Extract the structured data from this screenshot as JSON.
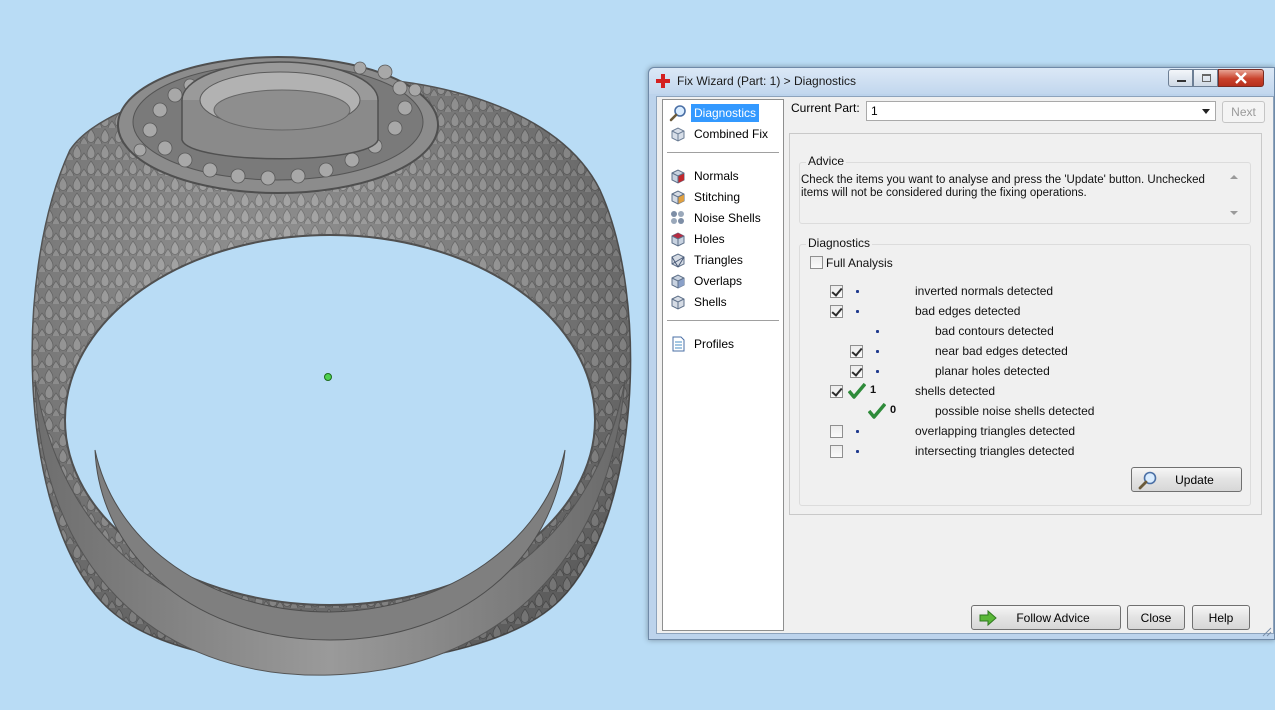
{
  "window": {
    "title": "Fix Wizard (Part: 1) > Diagnostics"
  },
  "nav": {
    "items": [
      {
        "label": "Diagnostics",
        "icon": "magnifier-icon",
        "selected": true
      },
      {
        "label": "Combined Fix",
        "icon": "cube-stack-icon"
      },
      {
        "label": "Normals",
        "icon": "normals-cube-icon"
      },
      {
        "label": "Stitching",
        "icon": "stitching-cube-icon"
      },
      {
        "label": "Noise Shells",
        "icon": "noise-shells-icon"
      },
      {
        "label": "Holes",
        "icon": "holes-cube-icon"
      },
      {
        "label": "Triangles",
        "icon": "triangles-cube-icon"
      },
      {
        "label": "Overlaps",
        "icon": "overlaps-cube-icon"
      },
      {
        "label": "Shells",
        "icon": "shells-cube-icon"
      },
      {
        "label": "Profiles",
        "icon": "document-icon"
      }
    ]
  },
  "part": {
    "label": "Current Part:",
    "value": "1",
    "next_label": "Next"
  },
  "advice": {
    "title": "Advice",
    "text": "Check the items you want to analyse and press the 'Update' button. Unchecked items will not be considered during the fixing operations."
  },
  "diagnostics": {
    "title": "Diagnostics",
    "full_analysis_label": "Full Analysis",
    "rows": [
      {
        "label": "inverted normals detected",
        "checked": true,
        "status": "dot"
      },
      {
        "label": "bad edges detected",
        "checked": true,
        "status": "dot"
      },
      {
        "label": "bad contours detected",
        "checked": null,
        "status": "dot"
      },
      {
        "label": "near bad edges detected",
        "checked": true,
        "status": "dot"
      },
      {
        "label": "planar holes detected",
        "checked": true,
        "status": "dot"
      },
      {
        "label": "shells detected",
        "checked": true,
        "status": "ok",
        "count": "1"
      },
      {
        "label": "possible noise shells detected",
        "checked": null,
        "status": "ok",
        "count": "0"
      },
      {
        "label": "overlapping triangles detected",
        "checked": false,
        "status": "dot"
      },
      {
        "label": "intersecting triangles detected",
        "checked": false,
        "status": "dot"
      }
    ],
    "update_label": "Update"
  },
  "footer": {
    "follow_advice_label": "Follow Advice",
    "close_label": "Close",
    "help_label": "Help"
  },
  "colors": {
    "background": "#b9dcf5",
    "model_gray": "#8a8a8a",
    "selection": "#3399ff",
    "tick_green": "#2e8b3a"
  }
}
